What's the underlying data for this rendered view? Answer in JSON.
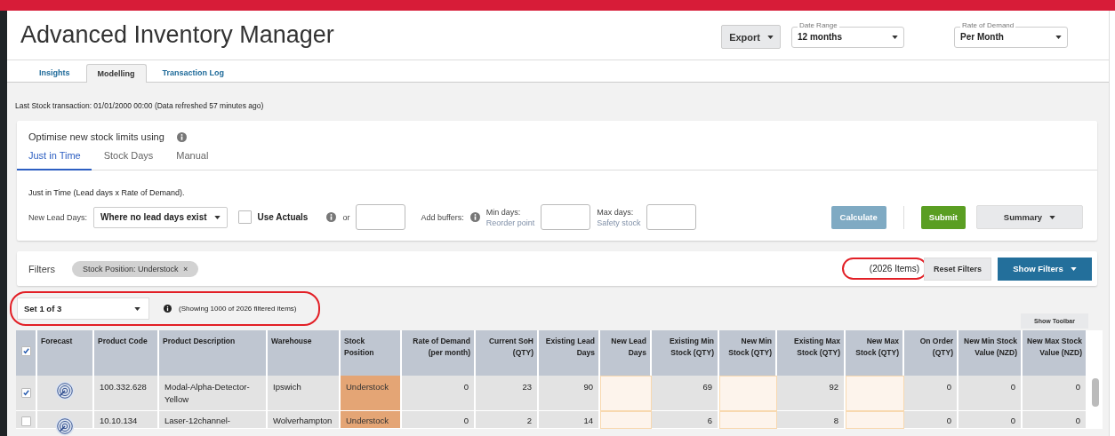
{
  "header": {
    "title": "Advanced Inventory Manager",
    "export_button": "Export",
    "date_range": {
      "label": "Date Range",
      "value": "12 months"
    },
    "rate_of_demand": {
      "label": "Rate of Demand",
      "value": "Per Month"
    }
  },
  "tabs": [
    {
      "label": "Insights",
      "selected": false
    },
    {
      "label": "Modelling",
      "selected": true
    },
    {
      "label": "Transaction Log",
      "selected": false
    }
  ],
  "last_transaction": "Last Stock transaction: 01/01/2000 00:00 (Data refreshed 57 minutes ago)",
  "optimise": {
    "title": "Optimise new stock limits using",
    "methods": [
      {
        "label": "Just in Time",
        "selected": true
      },
      {
        "label": "Stock Days",
        "selected": false
      },
      {
        "label": "Manual",
        "selected": false
      }
    ],
    "description": "Just in Time (Lead days x Rate of Demand).",
    "new_lead_days_label": "New Lead Days:",
    "lead_days_select": "Where no lead days exist",
    "use_actuals": {
      "label": "Use Actuals",
      "checked": false
    },
    "or_label": "or",
    "add_buffers_label": "Add buffers:",
    "min_days": {
      "label": "Min days:",
      "hint": "Reorder point"
    },
    "max_days": {
      "label": "Max days:",
      "hint": "Safety stock"
    },
    "calculate_button": {
      "label": "Calculate",
      "disabled": true
    },
    "submit_button": "Submit",
    "summary_button": "Summary"
  },
  "filters": {
    "label": "Filters",
    "chips": [
      {
        "label": "Stock Position: Understock",
        "remove": "×"
      }
    ],
    "items_count": "(2026 Items)",
    "reset_button": "Reset Filters",
    "show_filters_button": "Show Filters"
  },
  "set_select": "Set 1 of 3",
  "showing_text": "(Showing 1000 of 2026 filtered items)",
  "show_toolbar_button": "Show Toolbar",
  "table": {
    "header_checked": true,
    "columns": [
      {
        "label": "Forecast",
        "kind": "icon"
      },
      {
        "label": "Product Code",
        "kind": "text"
      },
      {
        "label": "Product Description",
        "kind": "text"
      },
      {
        "label": "Warehouse",
        "kind": "text"
      },
      {
        "label": "Stock Position",
        "kind": "status"
      },
      {
        "label": "Rate of Demand (per month)",
        "kind": "number"
      },
      {
        "label": "Current SoH (QTY)",
        "kind": "number"
      },
      {
        "label": "Existing Lead Days",
        "kind": "number"
      },
      {
        "label": "New Lead Days",
        "kind": "input"
      },
      {
        "label": "Existing Min Stock (QTY)",
        "kind": "number"
      },
      {
        "label": "New Min Stock (QTY)",
        "kind": "input"
      },
      {
        "label": "Existing Max Stock (QTY)",
        "kind": "number"
      },
      {
        "label": "New Max Stock (QTY)",
        "kind": "input"
      },
      {
        "label": "On Order (QTY)",
        "kind": "number"
      },
      {
        "label": "New Min Stock Value (NZD)",
        "kind": "number"
      },
      {
        "label": "New Max Stock Value (NZD)",
        "kind": "number"
      }
    ],
    "rows": [
      {
        "checked": true,
        "cells": [
          "",
          "100.332.628",
          "Modal-Alpha-Detector-Yellow",
          "Ipswich",
          "Understock",
          "0",
          "23",
          "90",
          "",
          "69",
          "",
          "92",
          "",
          "0",
          "0",
          "0"
        ]
      },
      {
        "checked": false,
        "cells": [
          "",
          "10.10.134",
          "Laser-12channel-",
          "Wolverhampton",
          "Understock",
          "0",
          "2",
          "14",
          "",
          "6",
          "",
          "8",
          "",
          "0",
          "0",
          "0"
        ]
      }
    ]
  }
}
